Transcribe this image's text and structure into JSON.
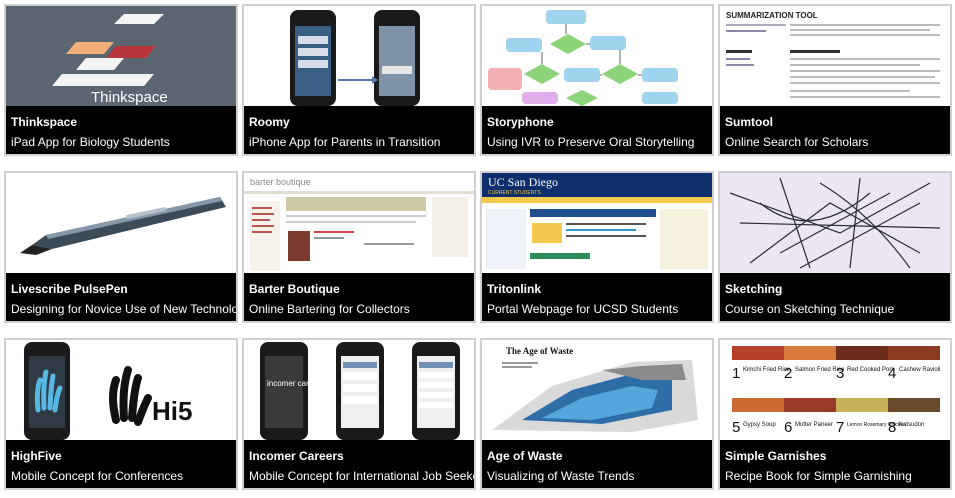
{
  "projects": [
    {
      "title": "Thinkspace",
      "subtitle": "iPad App for Biology Students",
      "thumb_text": "Thinkspace"
    },
    {
      "title": "Roomy",
      "subtitle": "iPhone App for Parents in Transition"
    },
    {
      "title": "Storyphone",
      "subtitle": "Using IVR to Preserve Oral Storytelling"
    },
    {
      "title": "Sumtool",
      "subtitle": "Online Search for Scholars",
      "thumb_text": "SUMMARIZATION TOOL"
    },
    {
      "title": "Livescribe PulsePen",
      "subtitle": "Designing for Novice Use of New Technology"
    },
    {
      "title": "Barter Boutique",
      "subtitle": "Online Bartering for Collectors",
      "thumb_text": "barter boutique"
    },
    {
      "title": "Tritonlink",
      "subtitle": "Portal Webpage for UCSD Students",
      "thumb_text": "UC San Diego",
      "thumb_sub": "CURRENT STUDENTS"
    },
    {
      "title": "Sketching",
      "subtitle": "Course on Sketching Technique"
    },
    {
      "title": "HighFive",
      "subtitle": "Mobile Concept for Conferences",
      "thumb_text": "Hi5"
    },
    {
      "title": "Incomer Careers",
      "subtitle": "Mobile Concept for International Job Seekers",
      "thumb_text": "incomer careers"
    },
    {
      "title": "Age of Waste",
      "subtitle": "Visualizing of Waste Trends",
      "thumb_text": "The Age of Waste"
    },
    {
      "title": "Simple Garnishes",
      "subtitle": "Recipe Book for Simple Garnishing",
      "recipes": [
        {
          "num": "1",
          "name": "Kimchi Fried Rice"
        },
        {
          "num": "2",
          "name": "Salmon Fried Rice"
        },
        {
          "num": "3",
          "name": "Red Cooked Pork"
        },
        {
          "num": "4",
          "name": "Cashew Ravioli"
        },
        {
          "num": "5",
          "name": "Gypsy Soup"
        },
        {
          "num": "6",
          "name": "Mutter Paneer"
        },
        {
          "num": "7",
          "name": "Lemon Rosemary Chicken"
        },
        {
          "num": "8",
          "name": "Katsudon"
        }
      ]
    }
  ]
}
